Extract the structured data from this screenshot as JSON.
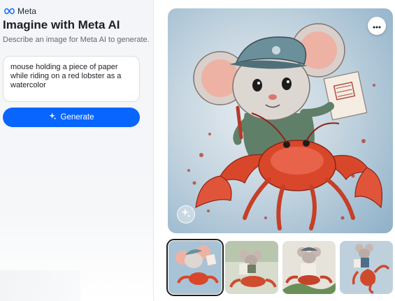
{
  "brand": {
    "name": "Meta"
  },
  "header": {
    "title": "Imagine with Meta AI",
    "subtitle": "Describe an image for Meta AI to generate."
  },
  "prompt": {
    "value": "mouse holding a piece of paper while riding on a red lobster as a watercolor"
  },
  "actions": {
    "generate_label": "Generate"
  },
  "icons": {
    "brand_logo": "meta-infinity-icon",
    "generate": "sparkle-icon",
    "more": "more-horizontal-icon",
    "ai_badge": "sparkle-icon"
  },
  "colors": {
    "accent": "#0866ff",
    "lobster": "#d9472b",
    "sky": "#9fbcd3"
  },
  "gallery": {
    "selected_index": 0,
    "thumbnails": [
      "thumbnail-1",
      "thumbnail-2",
      "thumbnail-3",
      "thumbnail-4"
    ]
  }
}
